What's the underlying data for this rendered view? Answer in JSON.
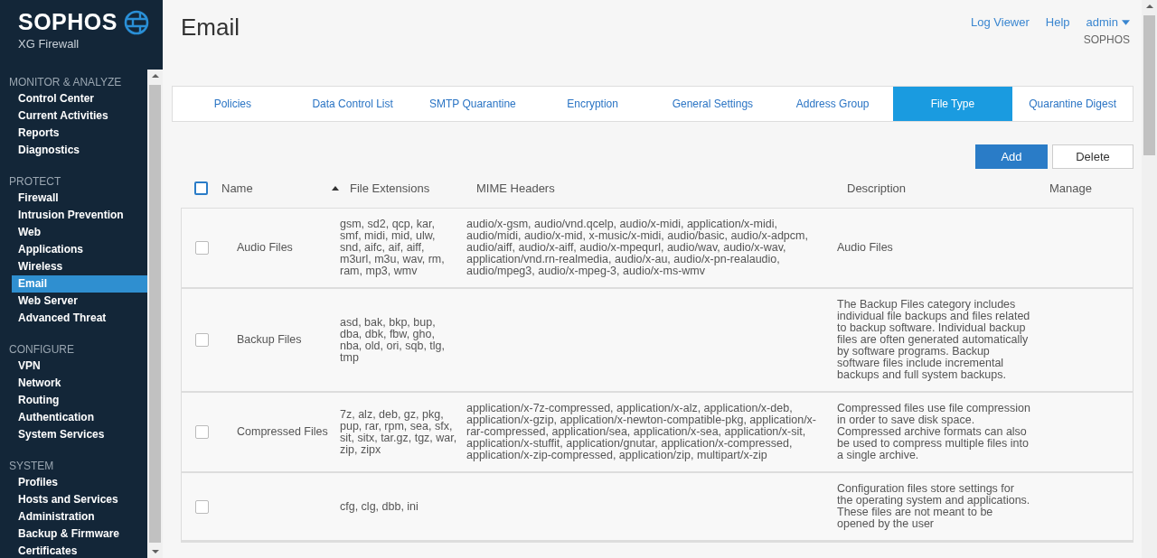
{
  "brand": {
    "logo": "SOPHOS",
    "product": "XG Firewall"
  },
  "sidebar": {
    "sections": [
      {
        "title": "MONITOR & ANALYZE",
        "items": [
          {
            "label": "Control Center",
            "selected": false
          },
          {
            "label": "Current Activities",
            "selected": false
          },
          {
            "label": "Reports",
            "selected": false
          },
          {
            "label": "Diagnostics",
            "selected": false
          }
        ]
      },
      {
        "title": "PROTECT",
        "items": [
          {
            "label": "Firewall",
            "selected": false
          },
          {
            "label": "Intrusion Prevention",
            "selected": false
          },
          {
            "label": "Web",
            "selected": false
          },
          {
            "label": "Applications",
            "selected": false
          },
          {
            "label": "Wireless",
            "selected": false
          },
          {
            "label": "Email",
            "selected": true
          },
          {
            "label": "Web Server",
            "selected": false
          },
          {
            "label": "Advanced Threat",
            "selected": false
          }
        ]
      },
      {
        "title": "CONFIGURE",
        "items": [
          {
            "label": "VPN",
            "selected": false
          },
          {
            "label": "Network",
            "selected": false
          },
          {
            "label": "Routing",
            "selected": false
          },
          {
            "label": "Authentication",
            "selected": false
          },
          {
            "label": "System Services",
            "selected": false
          }
        ]
      },
      {
        "title": "SYSTEM",
        "items": [
          {
            "label": "Profiles",
            "selected": false
          },
          {
            "label": "Hosts and Services",
            "selected": false
          },
          {
            "label": "Administration",
            "selected": false
          },
          {
            "label": "Backup & Firmware",
            "selected": false
          },
          {
            "label": "Certificates",
            "selected": false
          }
        ]
      }
    ]
  },
  "page": {
    "title": "Email"
  },
  "header": {
    "links": [
      "Log Viewer",
      "Help"
    ],
    "user": "admin",
    "org": "SOPHOS"
  },
  "tabs": [
    {
      "label": "Policies",
      "selected": false
    },
    {
      "label": "Data Control List",
      "selected": false
    },
    {
      "label": "SMTP Quarantine",
      "selected": false
    },
    {
      "label": "Encryption",
      "selected": false
    },
    {
      "label": "General Settings",
      "selected": false
    },
    {
      "label": "Address Group",
      "selected": false
    },
    {
      "label": "File Type",
      "selected": true
    },
    {
      "label": "Quarantine Digest",
      "selected": false
    }
  ],
  "actions": [
    "Add",
    "Delete"
  ],
  "table": {
    "select_all": {
      "checked": false
    },
    "columns": [
      "Name",
      "File Extensions",
      "MIME Headers",
      "Description",
      "Manage"
    ],
    "rows": [
      {
        "checked": false,
        "name": "Audio Files",
        "extensions": "gsm, sd2, qcp, kar, smf, midi, mid, ulw, snd, aifc, aif, aiff, m3url, m3u, wav, rm, ram, mp3, wmv",
        "mime": "audio/x-gsm, audio/vnd.qcelp, audio/x-midi, application/x-midi, audio/midi, audio/x-mid, x-music/x-midi, audio/basic, audio/x-adpcm, audio/aiff, audio/x-aiff, audio/x-mpequrl, audio/wav, audio/x-wav, application/vnd.rn-realmedia, audio/x-au, audio/x-pn-realaudio, audio/mpeg3, audio/x-mpeg-3, audio/x-ms-wmv",
        "description": "Audio Files"
      },
      {
        "checked": false,
        "name": "Backup Files",
        "extensions": "asd, bak, bkp, bup, dba, dbk, fbw, gho, nba, old, ori, sqb, tlg, tmp",
        "mime": "",
        "description": "The Backup Files category includes individual file backups and files related to backup software. Individual backup files are often generated automatically by software programs. Backup software files include incremental backups and full system backups."
      },
      {
        "checked": false,
        "name": "Compressed Files",
        "extensions": "7z, alz, deb, gz, pkg, pup, rar, rpm, sea, sfx, sit, sitx, tar.gz, tgz, war, zip, zipx",
        "mime": "application/x-7z-compressed, application/x-alz, application/x-deb, application/x-gzip, application/x-newton-compatible-pkg, application/x-rar-compressed, application/sea, application/x-sea, application/x-sit, application/x-stuffit, application/gnutar, application/x-compressed, application/x-zip-compressed, application/zip, multipart/x-zip",
        "description": "Compressed files use file compression in order to save disk space. Compressed archive formats can also be used to compress multiple files into a single archive."
      },
      {
        "checked": false,
        "name": "",
        "extensions": "cfg, clg, dbb, ini",
        "mime": "",
        "description": "Configuration files store settings for the operating system and applications. These files are not meant to be opened by the user"
      }
    ]
  }
}
